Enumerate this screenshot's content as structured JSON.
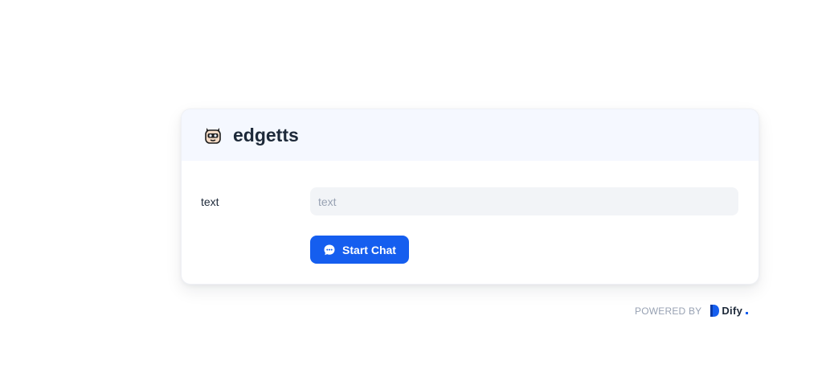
{
  "app": {
    "title": "edgetts",
    "icon": "robot-icon"
  },
  "form": {
    "fields": [
      {
        "label": "text",
        "placeholder": "text",
        "value": ""
      }
    ],
    "start_button": {
      "label": "Start Chat",
      "icon": "chat-bubble-icon"
    }
  },
  "footer": {
    "powered_by": "POWERED BY",
    "brand": "Dify"
  },
  "colors": {
    "accent": "#155eef",
    "header_bg": "#f5f8ff",
    "input_bg": "#f2f4f7",
    "title_text": "#1d2939",
    "muted_text": "#98a2b3"
  }
}
